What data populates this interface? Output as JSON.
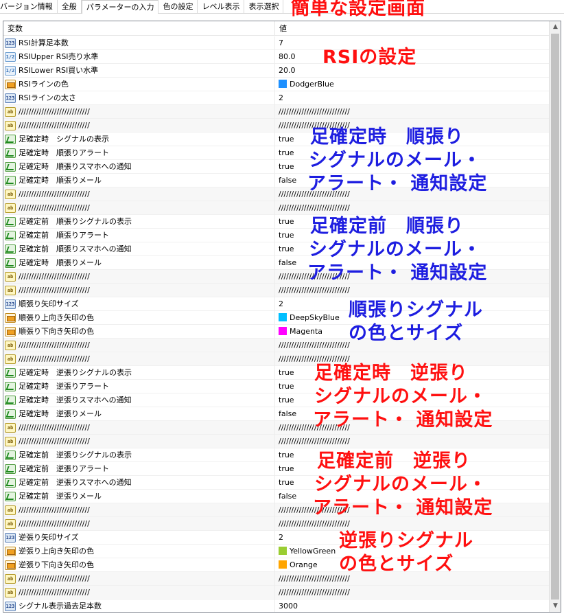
{
  "tabs": [
    "バージョン情報",
    "全般",
    "パラメーターの入力",
    "色の設定",
    "レベル表示",
    "表示選択"
  ],
  "active_tab": 2,
  "table": {
    "header_name": "変数",
    "header_value": "値",
    "rows": [
      {
        "icon": "int",
        "name": "RSI計算足本数",
        "value": "7"
      },
      {
        "icon": "dbl",
        "name": "RSIUpper RSI売り水準",
        "value": "80.0"
      },
      {
        "icon": "dbl",
        "name": "RSILower RSI買い水準",
        "value": "20.0"
      },
      {
        "icon": "clr",
        "name": "RSIラインの色",
        "value": "DodgerBlue",
        "color": "#1e90ff"
      },
      {
        "icon": "int",
        "name": "RSIラインの太さ",
        "value": "2"
      },
      {
        "icon": "str",
        "name": "////////////////////////////",
        "value": "////////////////////////////"
      },
      {
        "icon": "str",
        "name": "////////////////////////////",
        "value": "////////////////////////////"
      },
      {
        "icon": "bool",
        "name": "足確定時　シグナルの表示",
        "value": "true"
      },
      {
        "icon": "bool",
        "name": "足確定時　順張りアラート",
        "value": "true"
      },
      {
        "icon": "bool",
        "name": "足確定時　順張りスマホへの通知",
        "value": "true"
      },
      {
        "icon": "bool",
        "name": "足確定時　順張りメール",
        "value": "false"
      },
      {
        "icon": "str",
        "name": "////////////////////////////",
        "value": "////////////////////////////"
      },
      {
        "icon": "str",
        "name": "////////////////////////////",
        "value": "////////////////////////////"
      },
      {
        "icon": "bool",
        "name": "足確定前　順張りシグナルの表示",
        "value": "true"
      },
      {
        "icon": "bool",
        "name": "足確定前　順張りアラート",
        "value": "true"
      },
      {
        "icon": "bool",
        "name": "足確定前　順張りスマホへの通知",
        "value": "true"
      },
      {
        "icon": "bool",
        "name": "足確定時　順張りメール",
        "value": "false"
      },
      {
        "icon": "str",
        "name": "////////////////////////////",
        "value": "////////////////////////////"
      },
      {
        "icon": "str",
        "name": "////////////////////////////",
        "value": "////////////////////////////"
      },
      {
        "icon": "int",
        "name": "順張り矢印サイズ",
        "value": "2"
      },
      {
        "icon": "clr",
        "name": "順張り上向き矢印の色",
        "value": "DeepSkyBlue",
        "color": "#00bfff"
      },
      {
        "icon": "clr",
        "name": "順張り下向き矢印の色",
        "value": "Magenta",
        "color": "#ff00ff"
      },
      {
        "icon": "str",
        "name": "////////////////////////////",
        "value": "////////////////////////////"
      },
      {
        "icon": "str",
        "name": "////////////////////////////",
        "value": "////////////////////////////"
      },
      {
        "icon": "bool",
        "name": "足確定時　逆張りシグナルの表示",
        "value": "true"
      },
      {
        "icon": "bool",
        "name": "足確定時　逆張りアラート",
        "value": "true"
      },
      {
        "icon": "bool",
        "name": "足確定時　逆張りスマホへの通知",
        "value": "true"
      },
      {
        "icon": "bool",
        "name": "足確定時　逆張りメール",
        "value": "false"
      },
      {
        "icon": "str",
        "name": "////////////////////////////",
        "value": "////////////////////////////"
      },
      {
        "icon": "str",
        "name": "////////////////////////////",
        "value": "////////////////////////////"
      },
      {
        "icon": "bool",
        "name": "足確定前　逆張りシグナルの表示",
        "value": "true"
      },
      {
        "icon": "bool",
        "name": "足確定前　逆張りアラート",
        "value": "true"
      },
      {
        "icon": "bool",
        "name": "足確定前　逆張りスマホへの通知",
        "value": "true"
      },
      {
        "icon": "bool",
        "name": "足確定前　逆張りメール",
        "value": "false"
      },
      {
        "icon": "str",
        "name": "////////////////////////////",
        "value": "////////////////////////////"
      },
      {
        "icon": "str",
        "name": "////////////////////////////",
        "value": "////////////////////////////"
      },
      {
        "icon": "int",
        "name": "逆張り矢印サイズ",
        "value": "2"
      },
      {
        "icon": "clr",
        "name": "逆張り上向き矢印の色",
        "value": "YellowGreen",
        "color": "#9acd32"
      },
      {
        "icon": "clr",
        "name": "逆張り下向き矢印の色",
        "value": "Orange",
        "color": "#ffa500"
      },
      {
        "icon": "str",
        "name": "////////////////////////////",
        "value": "////////////////////////////"
      },
      {
        "icon": "str",
        "name": "////////////////////////////",
        "value": "////////////////////////////"
      },
      {
        "icon": "int",
        "name": "シグナル表示過去足本数",
        "value": "3000"
      }
    ]
  },
  "icon_labels": {
    "int": "123",
    "dbl": "1/2",
    "str": "ab"
  },
  "annotations": {
    "title": "簡単な設定画面",
    "rsi": "RSIの設定",
    "trend_close_1": "足確定時　順張り",
    "trend_close_2": "シグナルのメール・",
    "trend_close_3": "アラート・ 通知設定",
    "trend_open_1": "足確定前　順張り",
    "trend_open_2": "シグナルのメール・",
    "trend_open_3": "アラート・ 通知設定",
    "trend_arrow_1": "順張りシグナル",
    "trend_arrow_2": "の色とサイズ",
    "counter_close_1": "足確定時　逆張り",
    "counter_close_2": "シグナルのメール・",
    "counter_close_3": "アラート・ 通知設定",
    "counter_open_1": "足確定前　逆張り",
    "counter_open_2": "シグナルのメール・",
    "counter_open_3": "アラート・ 通知設定",
    "counter_arrow_1": "逆張りシグナル",
    "counter_arrow_2": "の色とサイズ"
  }
}
